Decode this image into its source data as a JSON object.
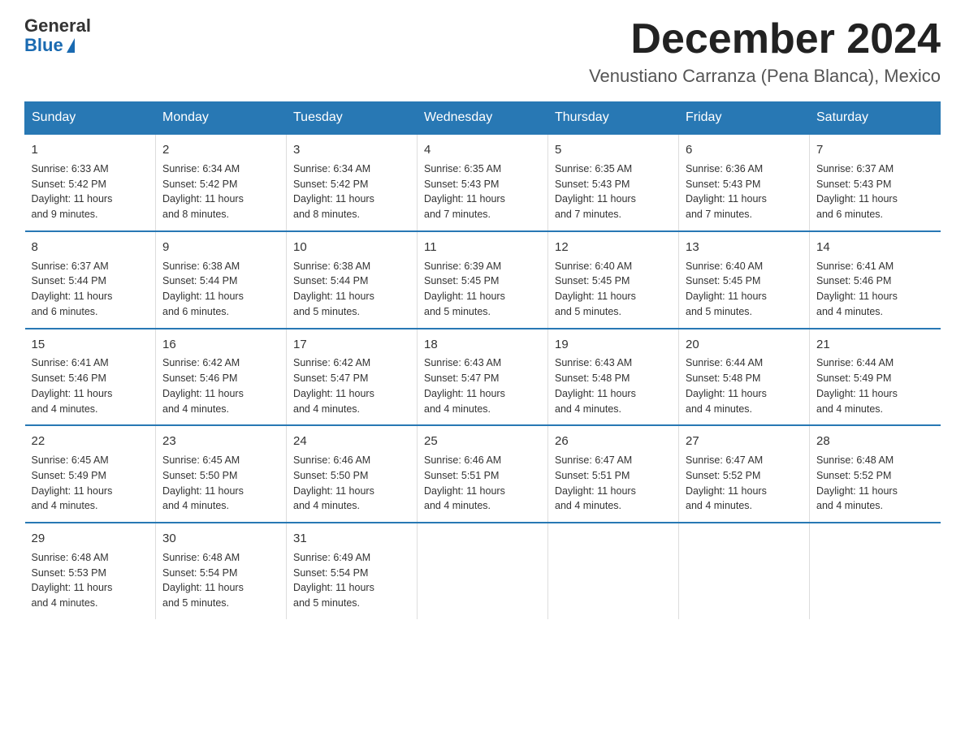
{
  "logo": {
    "general": "General",
    "blue": "Blue"
  },
  "header": {
    "month": "December 2024",
    "location": "Venustiano Carranza (Pena Blanca), Mexico"
  },
  "days_of_week": [
    "Sunday",
    "Monday",
    "Tuesday",
    "Wednesday",
    "Thursday",
    "Friday",
    "Saturday"
  ],
  "weeks": [
    [
      {
        "day": "1",
        "sunrise": "6:33 AM",
        "sunset": "5:42 PM",
        "daylight": "11 hours and 9 minutes."
      },
      {
        "day": "2",
        "sunrise": "6:34 AM",
        "sunset": "5:42 PM",
        "daylight": "11 hours and 8 minutes."
      },
      {
        "day": "3",
        "sunrise": "6:34 AM",
        "sunset": "5:42 PM",
        "daylight": "11 hours and 8 minutes."
      },
      {
        "day": "4",
        "sunrise": "6:35 AM",
        "sunset": "5:43 PM",
        "daylight": "11 hours and 7 minutes."
      },
      {
        "day": "5",
        "sunrise": "6:35 AM",
        "sunset": "5:43 PM",
        "daylight": "11 hours and 7 minutes."
      },
      {
        "day": "6",
        "sunrise": "6:36 AM",
        "sunset": "5:43 PM",
        "daylight": "11 hours and 7 minutes."
      },
      {
        "day": "7",
        "sunrise": "6:37 AM",
        "sunset": "5:43 PM",
        "daylight": "11 hours and 6 minutes."
      }
    ],
    [
      {
        "day": "8",
        "sunrise": "6:37 AM",
        "sunset": "5:44 PM",
        "daylight": "11 hours and 6 minutes."
      },
      {
        "day": "9",
        "sunrise": "6:38 AM",
        "sunset": "5:44 PM",
        "daylight": "11 hours and 6 minutes."
      },
      {
        "day": "10",
        "sunrise": "6:38 AM",
        "sunset": "5:44 PM",
        "daylight": "11 hours and 5 minutes."
      },
      {
        "day": "11",
        "sunrise": "6:39 AM",
        "sunset": "5:45 PM",
        "daylight": "11 hours and 5 minutes."
      },
      {
        "day": "12",
        "sunrise": "6:40 AM",
        "sunset": "5:45 PM",
        "daylight": "11 hours and 5 minutes."
      },
      {
        "day": "13",
        "sunrise": "6:40 AM",
        "sunset": "5:45 PM",
        "daylight": "11 hours and 5 minutes."
      },
      {
        "day": "14",
        "sunrise": "6:41 AM",
        "sunset": "5:46 PM",
        "daylight": "11 hours and 4 minutes."
      }
    ],
    [
      {
        "day": "15",
        "sunrise": "6:41 AM",
        "sunset": "5:46 PM",
        "daylight": "11 hours and 4 minutes."
      },
      {
        "day": "16",
        "sunrise": "6:42 AM",
        "sunset": "5:46 PM",
        "daylight": "11 hours and 4 minutes."
      },
      {
        "day": "17",
        "sunrise": "6:42 AM",
        "sunset": "5:47 PM",
        "daylight": "11 hours and 4 minutes."
      },
      {
        "day": "18",
        "sunrise": "6:43 AM",
        "sunset": "5:47 PM",
        "daylight": "11 hours and 4 minutes."
      },
      {
        "day": "19",
        "sunrise": "6:43 AM",
        "sunset": "5:48 PM",
        "daylight": "11 hours and 4 minutes."
      },
      {
        "day": "20",
        "sunrise": "6:44 AM",
        "sunset": "5:48 PM",
        "daylight": "11 hours and 4 minutes."
      },
      {
        "day": "21",
        "sunrise": "6:44 AM",
        "sunset": "5:49 PM",
        "daylight": "11 hours and 4 minutes."
      }
    ],
    [
      {
        "day": "22",
        "sunrise": "6:45 AM",
        "sunset": "5:49 PM",
        "daylight": "11 hours and 4 minutes."
      },
      {
        "day": "23",
        "sunrise": "6:45 AM",
        "sunset": "5:50 PM",
        "daylight": "11 hours and 4 minutes."
      },
      {
        "day": "24",
        "sunrise": "6:46 AM",
        "sunset": "5:50 PM",
        "daylight": "11 hours and 4 minutes."
      },
      {
        "day": "25",
        "sunrise": "6:46 AM",
        "sunset": "5:51 PM",
        "daylight": "11 hours and 4 minutes."
      },
      {
        "day": "26",
        "sunrise": "6:47 AM",
        "sunset": "5:51 PM",
        "daylight": "11 hours and 4 minutes."
      },
      {
        "day": "27",
        "sunrise": "6:47 AM",
        "sunset": "5:52 PM",
        "daylight": "11 hours and 4 minutes."
      },
      {
        "day": "28",
        "sunrise": "6:48 AM",
        "sunset": "5:52 PM",
        "daylight": "11 hours and 4 minutes."
      }
    ],
    [
      {
        "day": "29",
        "sunrise": "6:48 AM",
        "sunset": "5:53 PM",
        "daylight": "11 hours and 4 minutes."
      },
      {
        "day": "30",
        "sunrise": "6:48 AM",
        "sunset": "5:54 PM",
        "daylight": "11 hours and 5 minutes."
      },
      {
        "day": "31",
        "sunrise": "6:49 AM",
        "sunset": "5:54 PM",
        "daylight": "11 hours and 5 minutes."
      },
      {
        "day": "",
        "sunrise": "",
        "sunset": "",
        "daylight": ""
      },
      {
        "day": "",
        "sunrise": "",
        "sunset": "",
        "daylight": ""
      },
      {
        "day": "",
        "sunrise": "",
        "sunset": "",
        "daylight": ""
      },
      {
        "day": "",
        "sunrise": "",
        "sunset": "",
        "daylight": ""
      }
    ]
  ]
}
